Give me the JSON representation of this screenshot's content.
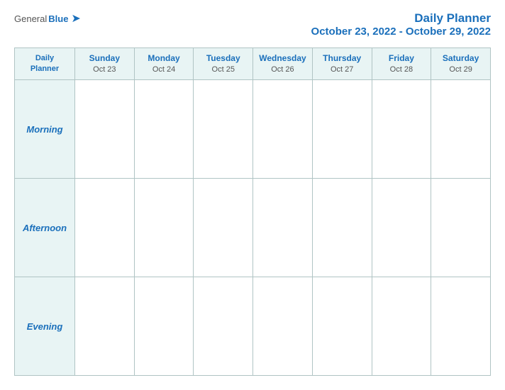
{
  "header": {
    "logo_general": "General",
    "logo_blue": "Blue",
    "title": "Daily Planner",
    "date_range": "October 23, 2022 - October 29, 2022"
  },
  "table": {
    "label_header_line1": "Daily",
    "label_header_line2": "Planner",
    "columns": [
      {
        "day": "Sunday",
        "date": "Oct 23"
      },
      {
        "day": "Monday",
        "date": "Oct 24"
      },
      {
        "day": "Tuesday",
        "date": "Oct 25"
      },
      {
        "day": "Wednesday",
        "date": "Oct 26"
      },
      {
        "day": "Thursday",
        "date": "Oct 27"
      },
      {
        "day": "Friday",
        "date": "Oct 28"
      },
      {
        "day": "Saturday",
        "date": "Oct 29"
      }
    ],
    "rows": [
      {
        "label": "Morning"
      },
      {
        "label": "Afternoon"
      },
      {
        "label": "Evening"
      }
    ]
  }
}
